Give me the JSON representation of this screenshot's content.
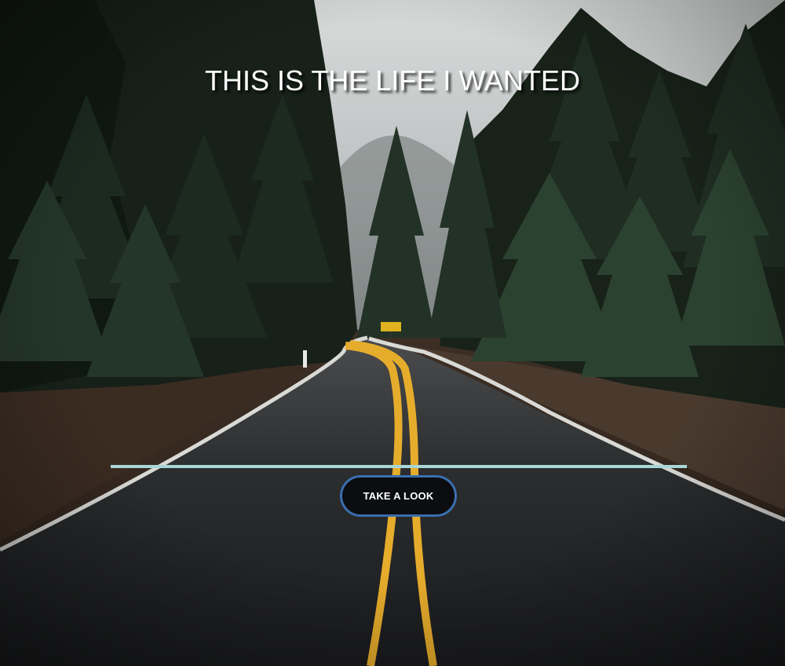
{
  "hero": {
    "title": "THIS IS THE LIFE I WANTED",
    "cta_label": "TAKE A LOOK"
  },
  "colors": {
    "divider": "#a9d6d6",
    "button_bg": "#0b0d10",
    "button_border": "#3a6fb0",
    "road_line": "#e6ac2c"
  }
}
